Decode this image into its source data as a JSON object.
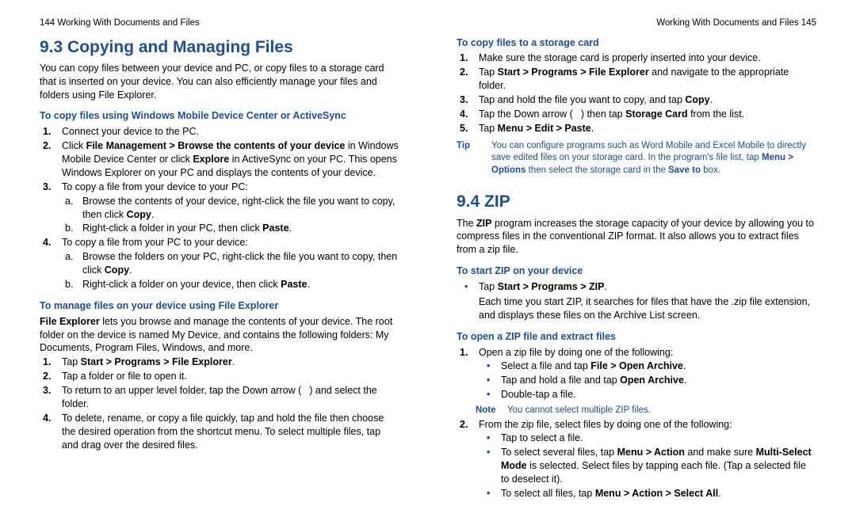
{
  "left": {
    "runhead": "144  Working With Documents and Files",
    "h1": "9.3  Copying and Managing Files",
    "intro": "You can copy files between your device and PC, or copy files to a storage card that is inserted on your device. You can also efficiently manage your files and folders using File Explorer.",
    "sub1": "To copy files using Windows Mobile Device Center or ActiveSync",
    "s1_1": "Connect your device to the PC.",
    "s1_2a": "Click ",
    "s1_2b": "File Management > Browse the contents of your device",
    "s1_2c": " in Windows Mobile Device Center or click ",
    "s1_2d": "Explore",
    "s1_2e": " in ActiveSync on your PC. This opens Windows Explorer on your PC and displays the contents of your device.",
    "s1_3": "To copy a file from your device to your PC:",
    "s1_3a_a": "Browse the contents of your device, right-click the file you want to copy, then click ",
    "s1_3a_b": "Copy",
    "s1_3a_c": ".",
    "s1_3b_a": "Right-click a folder in your PC, then click ",
    "s1_3b_b": "Paste",
    "s1_3b_c": ".",
    "s1_4": "To copy a file from your PC to your device:",
    "s1_4a_a": "Browse the folders on your PC, right-click the file you want to copy, then click ",
    "s1_4a_b": "Copy",
    "s1_4a_c": ".",
    "s1_4b_a": "Right-click a folder on your device, then click ",
    "s1_4b_b": "Paste",
    "s1_4b_c": ".",
    "sub2": "To manage files on your device using File Explorer",
    "fe_a": "File Explorer",
    "fe_b": " lets you browse and manage the contents of your device. The root folder on the device is named My Device, and contains the following folders: My Documents, Program Files, Windows, and more.",
    "m1_a": "Tap ",
    "m1_b": "Start > Programs > File Explorer",
    "m1_c": ".",
    "m2": "Tap a folder or file to open it.",
    "m3_a": "To return to an upper level folder, tap the Down arrow (",
    "m3_b": ") and select the folder.",
    "m4": "To delete, rename, or copy a file quickly, tap and hold the file then choose the desired operation from the shortcut menu. To select multiple files, tap and drag over the desired files."
  },
  "right": {
    "runhead": "Working With Documents and Files  145",
    "sub1": "To copy files to a storage card",
    "c1": "Make sure the storage card is properly inserted into your device.",
    "c2_a": "Tap ",
    "c2_b": "Start > Programs > File Explorer",
    "c2_c": " and navigate to the appropriate folder.",
    "c3_a": "Tap and hold the file you want to copy, and tap ",
    "c3_b": "Copy",
    "c3_c": ".",
    "c4_a": "Tap the Down arrow (",
    "c4_b": ") then tap ",
    "c4_c": "Storage Card",
    "c4_d": " from the list.",
    "c5_a": "Tap ",
    "c5_b": "Menu > Edit > Paste",
    "c5_c": ".",
    "tip_label": "Tip",
    "tip_a": "You can configure programs such as Word Mobile and Excel Mobile to directly save edited files on your storage card. In the program's file list, tap ",
    "tip_b": "Menu > Options",
    "tip_c": " then select the storage card in the ",
    "tip_d": "Save to",
    "tip_e": " box.",
    "h1": "9.4  ZIP",
    "zip_intro_a": "The ",
    "zip_intro_b": "ZIP",
    "zip_intro_c": " program increases the storage capacity of your device by allowing you to compress files in the conventional ZIP format. It also allows you to extract files from a zip file.",
    "sub2": "To start ZIP on your device",
    "z1_a": "Tap ",
    "z1_b": "Start > Programs > ZIP",
    "z1_c": ".",
    "z1_after": "Each time you start ZIP, it searches for files that have the .zip file extension, and displays these files on the Archive List screen.",
    "sub3": "To open a ZIP file and extract files",
    "o1": "Open a zip file by doing one of the following:",
    "o1_a_a": "Select a file and tap ",
    "o1_a_b": "File > Open Archive",
    "o1_a_c": ".",
    "o1_b_a": "Tap and hold a file and tap ",
    "o1_b_b": "Open Archive",
    "o1_b_c": ".",
    "o1_c": "Double-tap a file.",
    "note_label": "Note",
    "note_body": "You cannot select multiple ZIP files.",
    "o2": "From the zip file, select files by doing one of the following:",
    "o2_a": "Tap to select a file.",
    "o2_b_a": "To select several files, tap ",
    "o2_b_b": "Menu > Action",
    "o2_b_c": " and make sure ",
    "o2_b_d": "Multi-Select Mode",
    "o2_b_e": " is selected. Select files by tapping each file. (Tap a selected file to deselect it).",
    "o2_c_a": "To select all files, tap ",
    "o2_c_b": "Menu > Action > Select All",
    "o2_c_c": "."
  }
}
